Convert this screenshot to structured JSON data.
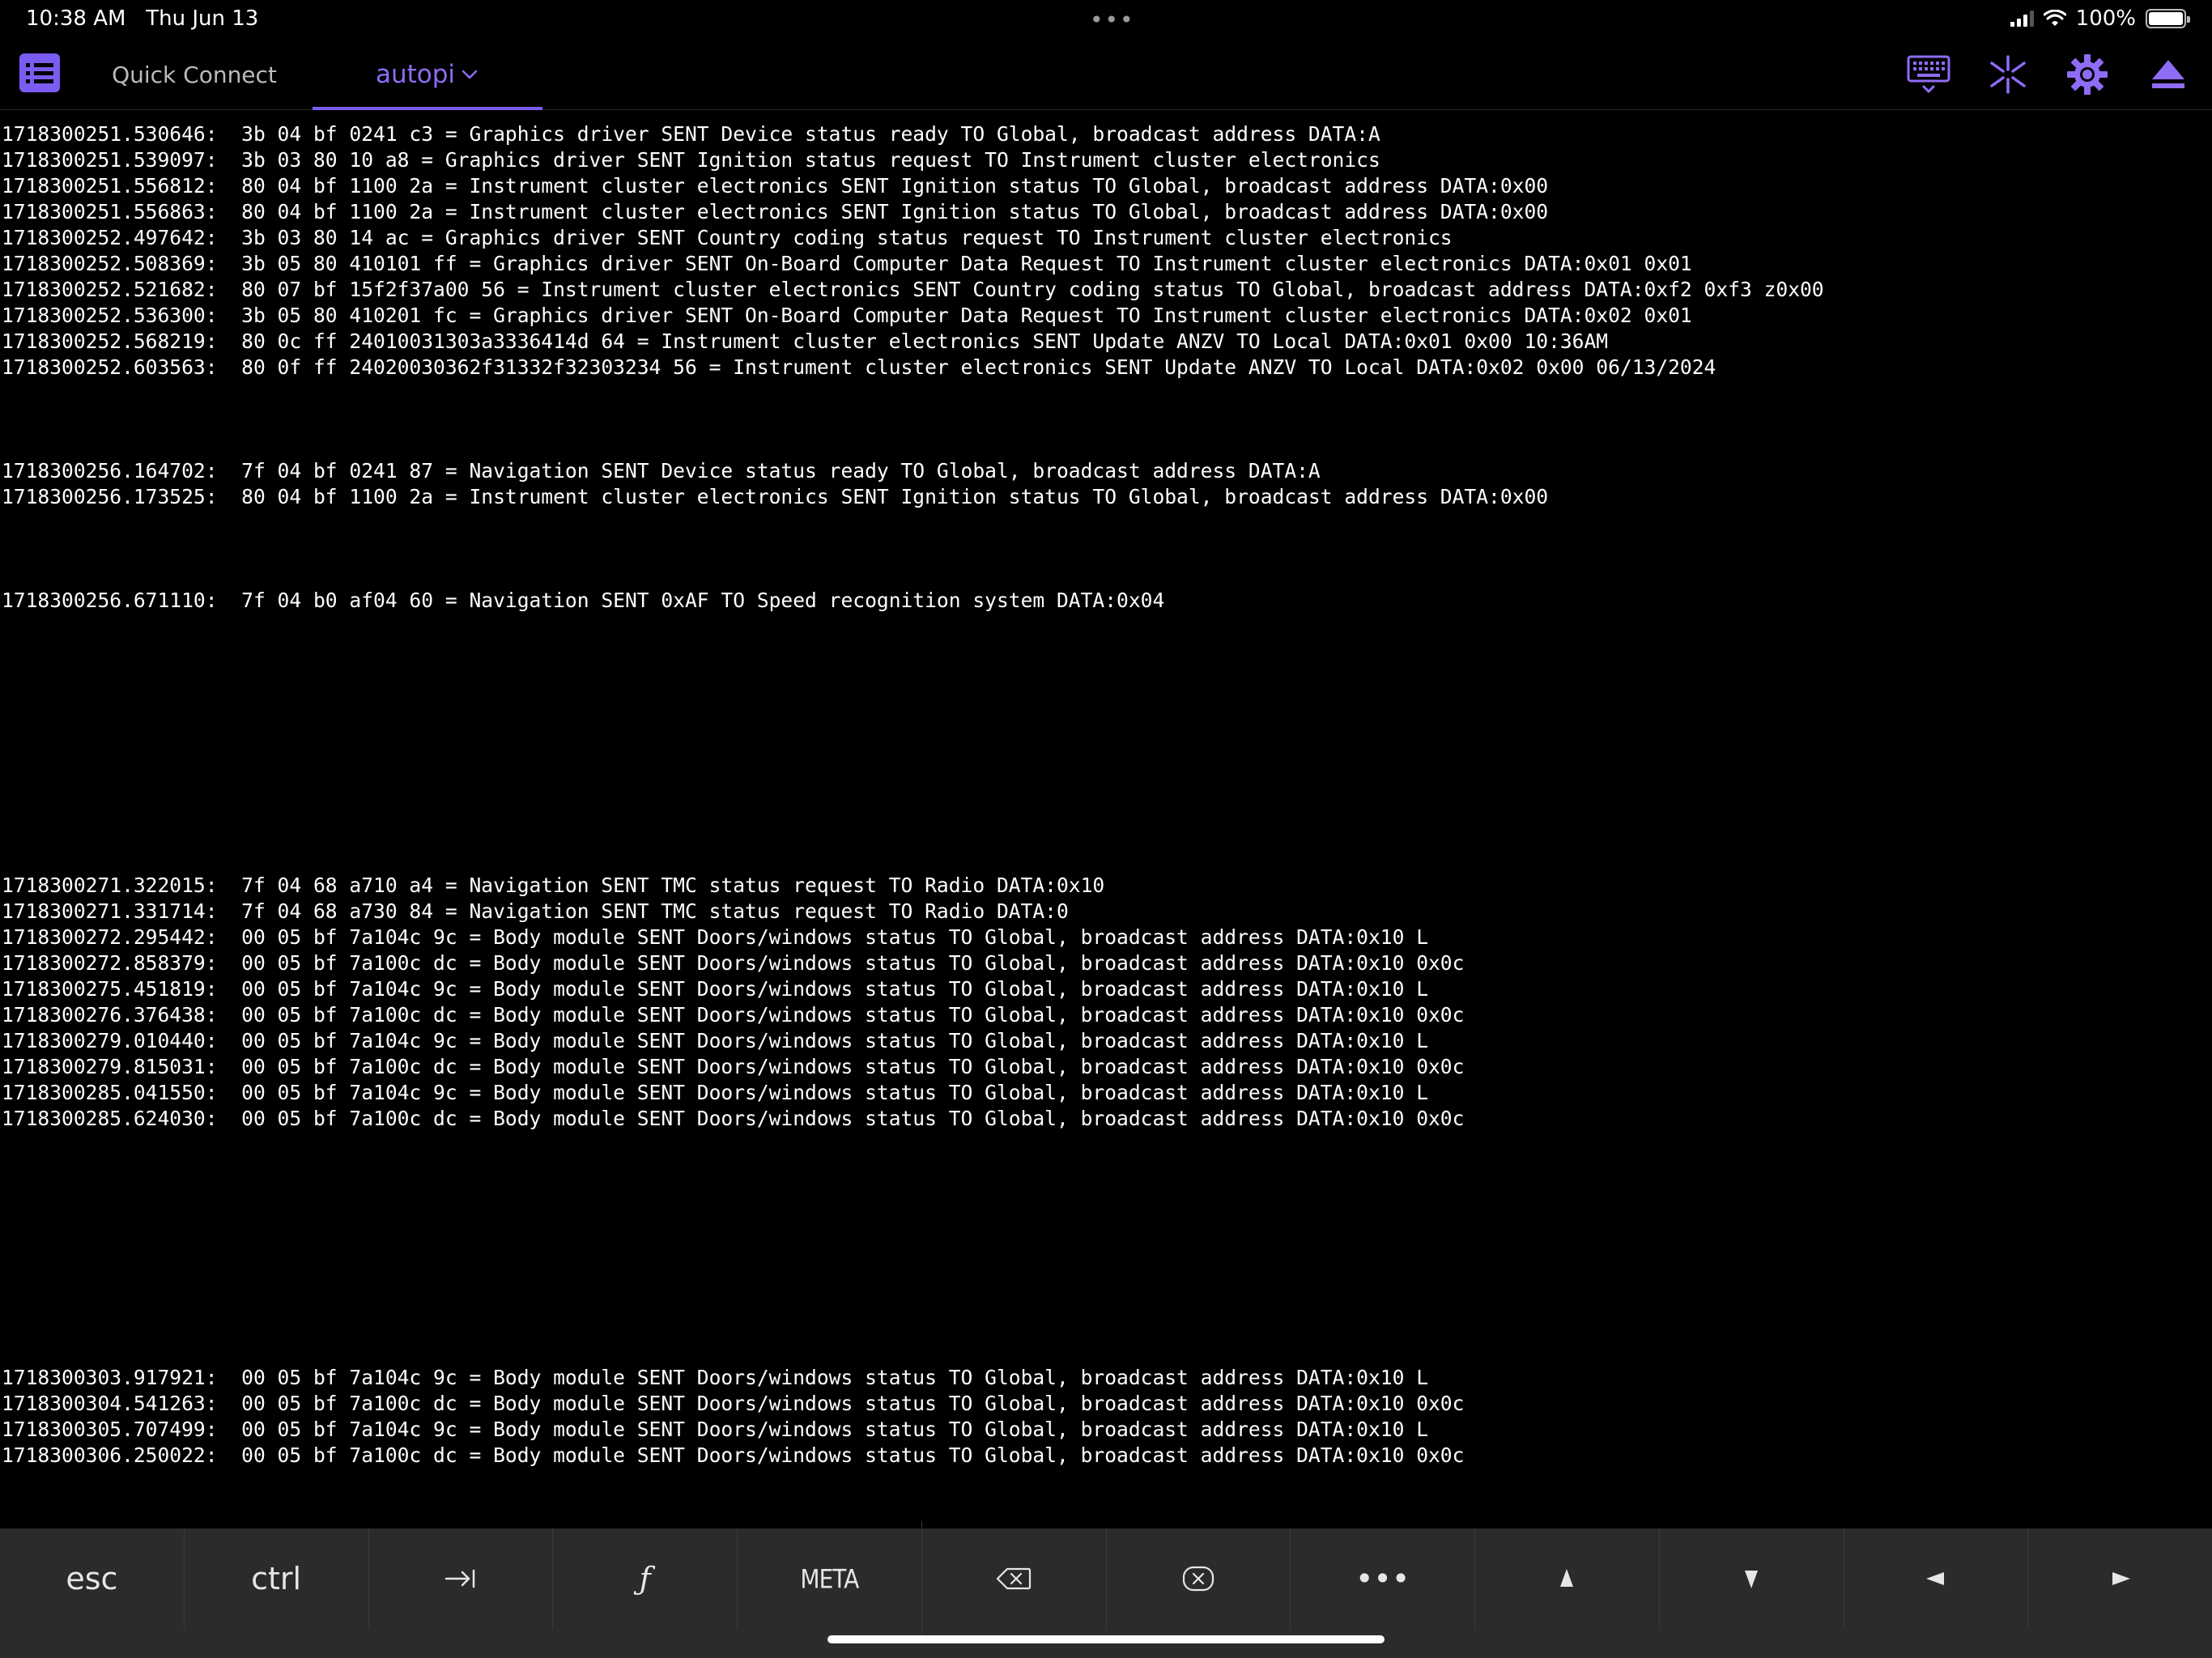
{
  "status_bar": {
    "time": "10:38 AM",
    "date": "Thu Jun 13",
    "battery_percent": "100%",
    "battery_level": 1.0,
    "signal_bars": 3
  },
  "toolbar": {
    "tabs": [
      {
        "label": "Quick Connect",
        "active": false
      },
      {
        "label": "autopi",
        "active": true
      }
    ],
    "accent_color": "#7b5cf0",
    "icons": [
      "list-icon",
      "keyboard-icon",
      "sparkle-icon",
      "gear-icon",
      "eject-icon"
    ]
  },
  "terminal": {
    "lines": [
      "1718300251.530646:  3b 04 bf 0241 c3 = Graphics driver SENT Device status ready TO Global, broadcast address DATA:A",
      "1718300251.539097:  3b 03 80 10 a8 = Graphics driver SENT Ignition status request TO Instrument cluster electronics",
      "1718300251.556812:  80 04 bf 1100 2a = Instrument cluster electronics SENT Ignition status TO Global, broadcast address DATA:0x00",
      "1718300251.556863:  80 04 bf 1100 2a = Instrument cluster electronics SENT Ignition status TO Global, broadcast address DATA:0x00",
      "1718300252.497642:  3b 03 80 14 ac = Graphics driver SENT Country coding status request TO Instrument cluster electronics",
      "1718300252.508369:  3b 05 80 410101 ff = Graphics driver SENT On-Board Computer Data Request TO Instrument cluster electronics DATA:0x01 0x01",
      "1718300252.521682:  80 07 bf 15f2f37a00 56 = Instrument cluster electronics SENT Country coding status TO Global, broadcast address DATA:0xf2 0xf3 z0x00",
      "1718300252.536300:  3b 05 80 410201 fc = Graphics driver SENT On-Board Computer Data Request TO Instrument cluster electronics DATA:0x02 0x01",
      "1718300252.568219:  80 0c ff 24010031303a3336414d 64 = Instrument cluster electronics SENT Update ANZV TO Local DATA:0x01 0x00 10:36AM",
      "1718300252.603563:  80 0f ff 24020030362f31332f32303234 56 = Instrument cluster electronics SENT Update ANZV TO Local DATA:0x02 0x00 06/13/2024",
      "",
      "",
      "",
      "1718300256.164702:  7f 04 bf 0241 87 = Navigation SENT Device status ready TO Global, broadcast address DATA:A",
      "1718300256.173525:  80 04 bf 1100 2a = Instrument cluster electronics SENT Ignition status TO Global, broadcast address DATA:0x00",
      "",
      "",
      "",
      "1718300256.671110:  7f 04 b0 af04 60 = Navigation SENT 0xAF TO Speed recognition system DATA:0x04",
      "",
      "",
      "",
      "",
      "",
      "",
      "",
      "",
      "",
      "",
      "1718300271.322015:  7f 04 68 a710 a4 = Navigation SENT TMC status request TO Radio DATA:0x10",
      "1718300271.331714:  7f 04 68 a730 84 = Navigation SENT TMC status request TO Radio DATA:0",
      "1718300272.295442:  00 05 bf 7a104c 9c = Body module SENT Doors/windows status TO Global, broadcast address DATA:0x10 L",
      "1718300272.858379:  00 05 bf 7a100c dc = Body module SENT Doors/windows status TO Global, broadcast address DATA:0x10 0x0c",
      "1718300275.451819:  00 05 bf 7a104c 9c = Body module SENT Doors/windows status TO Global, broadcast address DATA:0x10 L",
      "1718300276.376438:  00 05 bf 7a100c dc = Body module SENT Doors/windows status TO Global, broadcast address DATA:0x10 0x0c",
      "1718300279.010440:  00 05 bf 7a104c 9c = Body module SENT Doors/windows status TO Global, broadcast address DATA:0x10 L",
      "1718300279.815031:  00 05 bf 7a100c dc = Body module SENT Doors/windows status TO Global, broadcast address DATA:0x10 0x0c",
      "1718300285.041550:  00 05 bf 7a104c 9c = Body module SENT Doors/windows status TO Global, broadcast address DATA:0x10 L",
      "1718300285.624030:  00 05 bf 7a100c dc = Body module SENT Doors/windows status TO Global, broadcast address DATA:0x10 0x0c",
      "",
      "",
      "",
      "",
      "",
      "",
      "",
      "",
      "",
      "1718300303.917921:  00 05 bf 7a104c 9c = Body module SENT Doors/windows status TO Global, broadcast address DATA:0x10 L",
      "1718300304.541263:  00 05 bf 7a100c dc = Body module SENT Doors/windows status TO Global, broadcast address DATA:0x10 0x0c",
      "1718300305.707499:  00 05 bf 7a104c 9c = Body module SENT Doors/windows status TO Global, broadcast address DATA:0x10 L",
      "1718300306.250022:  00 05 bf 7a100c dc = Body module SENT Doors/windows status TO Global, broadcast address DATA:0x10 0x0c"
    ]
  },
  "keybar": {
    "esc": "esc",
    "ctrl": "ctrl",
    "fn": "ƒ",
    "meta": "META",
    "more": "•••",
    "icons": [
      "tab-icon",
      "function-icon",
      "meta-key",
      "delete-left-icon",
      "delete-right-icon",
      "more-icon",
      "arrow-up-icon",
      "arrow-down-icon",
      "arrow-left-icon",
      "arrow-right-icon"
    ]
  }
}
